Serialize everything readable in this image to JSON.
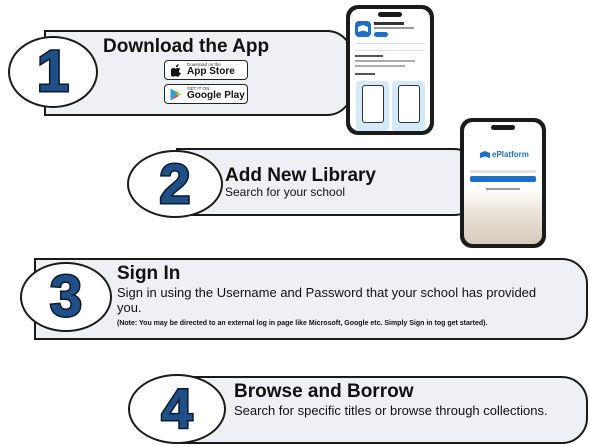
{
  "steps": [
    {
      "number": "1",
      "title": "Download the App",
      "description": ""
    },
    {
      "number": "2",
      "title": "Add New Library",
      "description": "Search for your school"
    },
    {
      "number": "3",
      "title": "Sign In",
      "description": "Sign in using the Username and Password that your school has provided you.",
      "note": "(Note: You may be directed to an external log in page like Microsoft, Google etc. Simply Sign in tog get started)."
    },
    {
      "number": "4",
      "title": "Browse and Borrow",
      "description": "Search for specific titles or browse through collections."
    }
  ],
  "app_store": {
    "small": "Download on the",
    "big": "App Store"
  },
  "google_play": {
    "small": "GET IT ON",
    "big": "Google Play"
  },
  "phone2": {
    "brand": "ePlatform"
  },
  "colors": {
    "number_fill": "#1f4f86",
    "banner_bg": "#eef0f3",
    "brand_blue": "#1f6fc4"
  }
}
